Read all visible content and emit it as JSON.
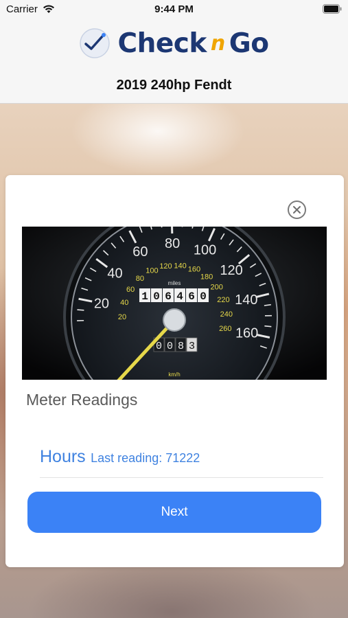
{
  "status_bar": {
    "carrier": "Carrier",
    "time": "9:44 PM"
  },
  "header": {
    "logo_text_check": "Check",
    "logo_text_n": "n",
    "logo_text_go": "Go",
    "vehicle_title": "2019 240hp Fendt"
  },
  "card": {
    "section_title": "Meter Readings",
    "hours_label": "Hours",
    "last_reading": "Last reading: 71222",
    "next_label": "Next"
  },
  "meter_image": {
    "outer_labels": [
      "20",
      "40",
      "60",
      "80",
      "100",
      "120",
      "140",
      "160"
    ],
    "inner_labels": [
      "20",
      "40",
      "60",
      "80",
      "100",
      "120",
      "140",
      "160",
      "180",
      "200",
      "220",
      "240",
      "260"
    ],
    "odometer": [
      "1",
      "0",
      "6",
      "4",
      "6",
      "0"
    ],
    "trip": [
      "0",
      "0",
      "8",
      "3"
    ],
    "odometer_unit": "miles",
    "speed_unit": "km/h"
  },
  "colors": {
    "accent": "#3b82f6",
    "link_text": "#3f82e0",
    "logo_navy": "#1c3773",
    "logo_orange": "#f0a500",
    "gauge_yellow": "#e6d84a"
  }
}
